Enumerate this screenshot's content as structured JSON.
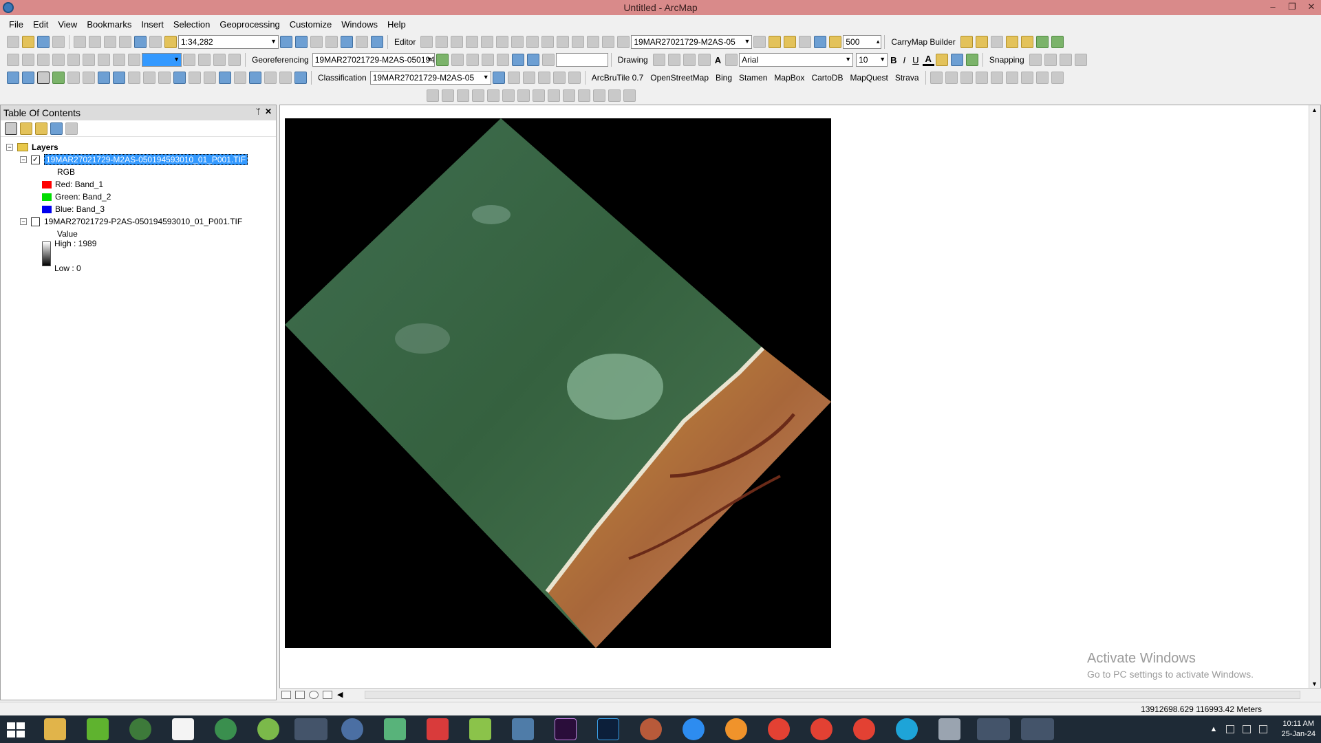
{
  "window": {
    "title": "Untitled - ArcMap",
    "controls": [
      "–",
      "❐",
      "✕"
    ]
  },
  "menu": [
    "File",
    "Edit",
    "View",
    "Bookmarks",
    "Insert",
    "Selection",
    "Geoprocessing",
    "Customize",
    "Windows",
    "Help"
  ],
  "toolbar1": {
    "scale": "1:34,282",
    "editor": "Editor",
    "layer_combo": "19MAR27021729-M2AS-05",
    "zoom_value": "500",
    "carrymap": "CarryMap Builder"
  },
  "toolbar2": {
    "georeferencing": "Georeferencing",
    "geo_layer": "19MAR27021729-M2AS-050194",
    "drawing": "Drawing",
    "font": "Arial",
    "font_size": "10",
    "bold": "B",
    "italic": "I",
    "underline": "U",
    "font_color_a": "A",
    "snapping": "Snapping"
  },
  "toolbar3": {
    "classification": "Classification",
    "class_layer": "19MAR27021729-M2AS-05",
    "arcbrutile": "ArcBruTile 0.7",
    "osm": "OpenStreetMap",
    "bing": "Bing",
    "stamen": "Stamen",
    "mapbox": "MapBox",
    "cartodb": "CartoDB",
    "mapquest": "MapQuest",
    "strava": "Strava"
  },
  "toc": {
    "title": "Table Of Contents",
    "pin": "ᛘ",
    "close": "✕",
    "root": "Layers",
    "layer1": {
      "name": "19MAR27021729-M2AS-050194593010_01_P001.TIF",
      "checked": "✓",
      "rgb": "RGB",
      "bands": [
        {
          "label": "Red:",
          "band": "Band_1",
          "color": "#ff0000"
        },
        {
          "label": "Green:",
          "band": "Band_2",
          "color": "#00dd00"
        },
        {
          "label": "Blue:",
          "band": "Band_3",
          "color": "#0000ee"
        }
      ]
    },
    "layer2": {
      "name": "19MAR27021729-P2AS-050194593010_01_P001.TIF",
      "value": "Value",
      "high": "High : 1989",
      "low": "Low : 0"
    }
  },
  "map": {
    "watermark_title": "Activate Windows",
    "watermark_sub": "Go to PC settings to activate Windows."
  },
  "status": {
    "coordinates": "13912698.629  116993.42 Meters"
  },
  "taskbar": {
    "time": "10:11 AM",
    "date": "25-Jan-24"
  }
}
